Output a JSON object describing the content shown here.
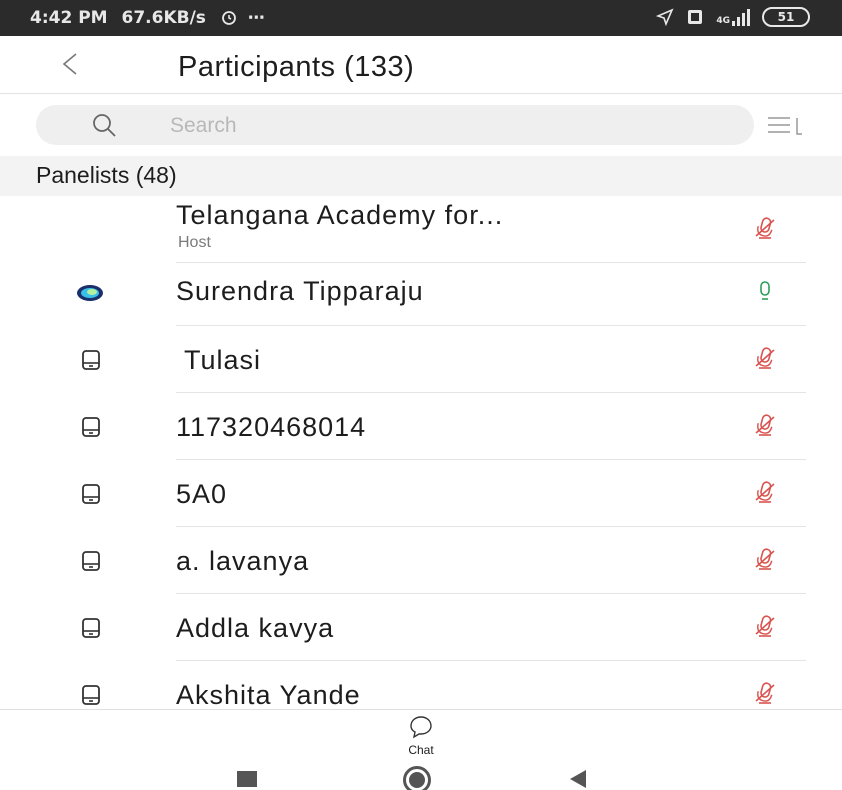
{
  "status_bar": {
    "time": "4:42 PM",
    "speed": "67.6KB/s",
    "dots": "⋯",
    "network_type": "4G",
    "battery": "51"
  },
  "header": {
    "title": "Participants (133)",
    "back_icon": "chevron-left-icon"
  },
  "search": {
    "placeholder": "Search",
    "search_icon": "search-icon",
    "sort_icon": "sort-list-icon"
  },
  "section": {
    "title": "Panelists (48)"
  },
  "participants": [
    {
      "name": "Telangana Academy for...",
      "role": "Host",
      "device_icon": "",
      "mic": "muted"
    },
    {
      "name": "Surendra Tipparaju",
      "role": "",
      "device_icon": "app-logo-icon",
      "mic": "unmuted"
    },
    {
      "name": " Tulasi",
      "role": "",
      "device_icon": "phone-icon",
      "mic": "muted"
    },
    {
      "name": "117320468014",
      "role": "",
      "device_icon": "phone-icon",
      "mic": "muted"
    },
    {
      "name": "5A0",
      "role": "",
      "device_icon": "phone-icon",
      "mic": "muted"
    },
    {
      "name": "a. lavanya",
      "role": "",
      "device_icon": "phone-icon",
      "mic": "muted"
    },
    {
      "name": "Addla kavya",
      "role": "",
      "device_icon": "phone-icon",
      "mic": "muted"
    },
    {
      "name": "Akshita Yande",
      "role": "",
      "device_icon": "phone-icon",
      "mic": "muted"
    }
  ],
  "bottom_bar": {
    "chat_label": "Chat",
    "chat_icon": "chat-bubble-icon"
  },
  "colors": {
    "muted_mic": "#d9534f",
    "unmuted_mic": "#2e9e5b",
    "status_bar_bg": "#2b2b2b"
  }
}
